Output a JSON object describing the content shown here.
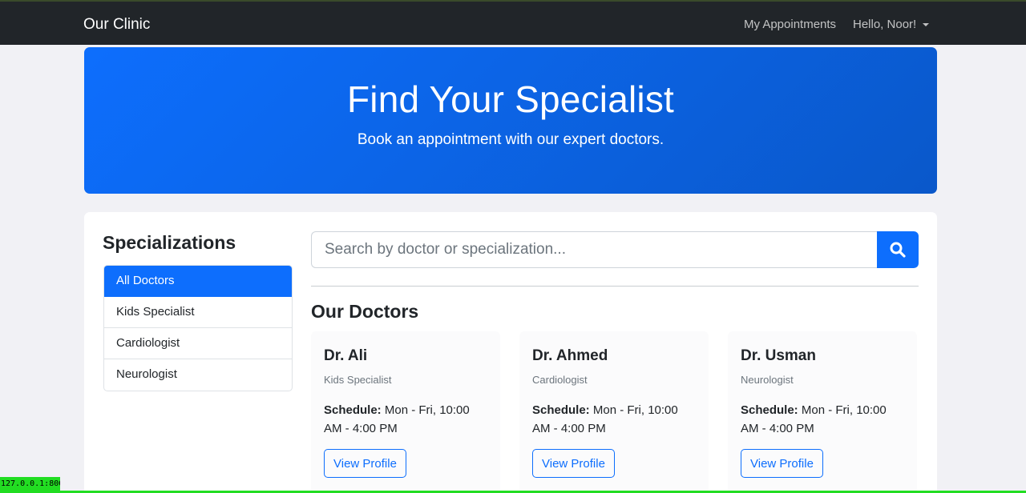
{
  "navbar": {
    "brand": "Our Clinic",
    "links": [
      "My Appointments",
      "Hello, Noor!"
    ]
  },
  "hero": {
    "title": "Find Your Specialist",
    "subtitle": "Book an appointment with our expert doctors."
  },
  "sidebar": {
    "heading": "Specializations",
    "items": [
      {
        "label": "All Doctors",
        "active": true
      },
      {
        "label": "Kids Specialist",
        "active": false
      },
      {
        "label": "Cardiologist",
        "active": false
      },
      {
        "label": "Neurologist",
        "active": false
      }
    ]
  },
  "search": {
    "placeholder": "Search by doctor or specialization...",
    "value": "",
    "button_icon": "search-icon"
  },
  "doctors": {
    "heading": "Our Doctors",
    "schedule_label": "Schedule:",
    "button_label": "View Profile",
    "list": [
      {
        "name": "Dr. Ali",
        "specialization": "Kids Specialist",
        "schedule": "Mon - Fri, 10:00 AM - 4:00 PM"
      },
      {
        "name": "Dr. Ahmed",
        "specialization": "Cardiologist",
        "schedule": "Mon - Fri, 10:00 AM - 4:00 PM"
      },
      {
        "name": "Dr. Usman",
        "specialization": "Neurologist",
        "schedule": "Mon - Fri, 10:00 AM - 4:00 PM"
      }
    ]
  },
  "status_bar": {
    "text": "127.0.0.1:8000"
  },
  "colors": {
    "navbar": "#212529",
    "primary": "#0d6efd",
    "primary_dark": "#0a58ca",
    "page_background": "#f1f1f5",
    "status_green": "#22dd22"
  }
}
